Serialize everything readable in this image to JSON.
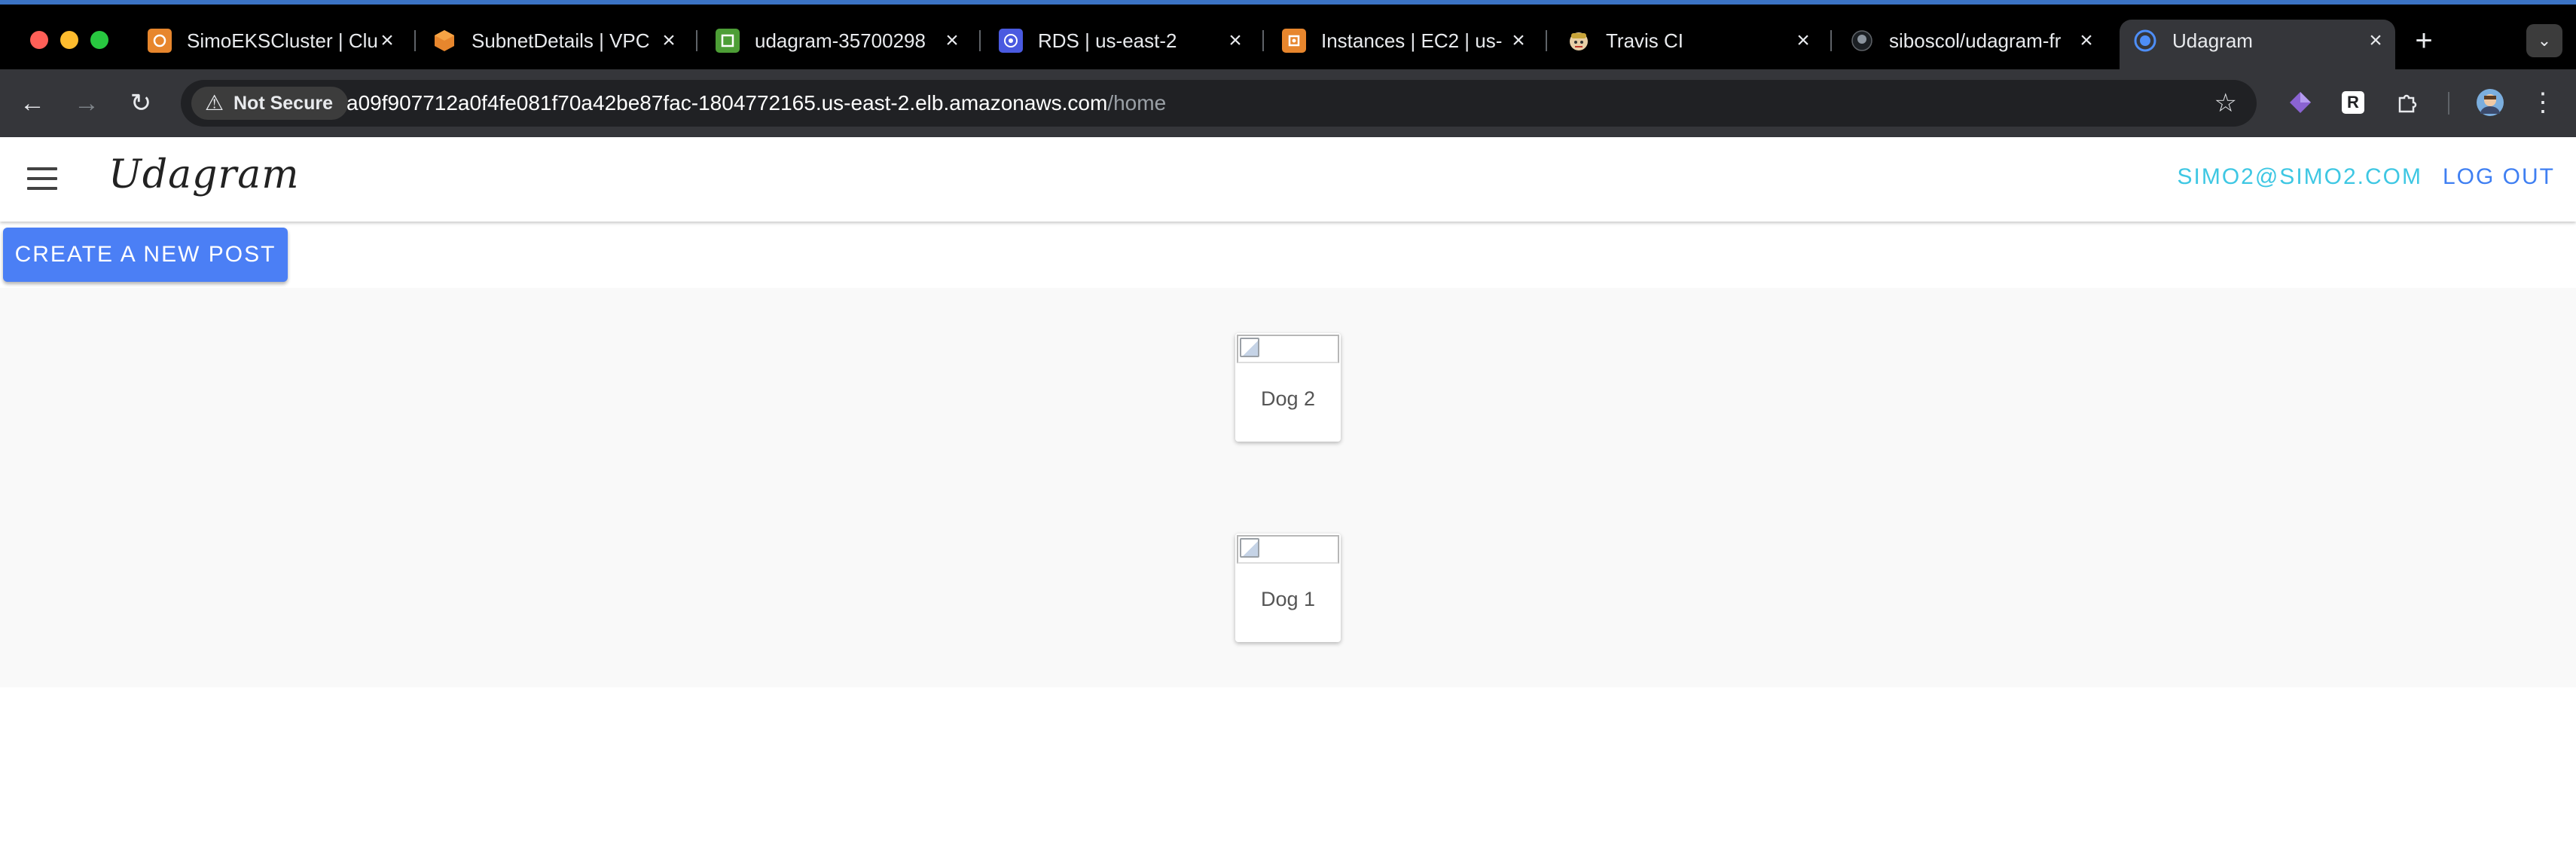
{
  "browser": {
    "tabs": [
      {
        "label": "SimoEKSCluster | Clu",
        "icon": "aws-eks-icon",
        "color": "#e7862d"
      },
      {
        "label": "SubnetDetails | VPC",
        "icon": "aws-vpc-icon",
        "color": "#e7862d"
      },
      {
        "label": "udagram-35700298",
        "icon": "aws-elb-icon",
        "color": "#4d9e36"
      },
      {
        "label": "RDS | us-east-2",
        "icon": "aws-rds-icon",
        "color": "#4a5ae0"
      },
      {
        "label": "Instances | EC2 | us-",
        "icon": "aws-ec2-icon",
        "color": "#e7862d"
      },
      {
        "label": "Travis CI",
        "icon": "travis-ci-icon",
        "color": "#c8a43a"
      },
      {
        "label": "siboscol/udagram-fr",
        "icon": "github-icon",
        "color": "#24292e"
      },
      {
        "label": "Udagram",
        "icon": "chrome-default-icon",
        "color": "#4e8ef7"
      }
    ],
    "security_label": "Not Secure",
    "url_host": "a09f907712a0f4fe081f70a42be87fac-1804772165.us-east-2.elb.amazonaws.com",
    "url_path": "/home",
    "extensions": [
      {
        "icon": "gem-extension-icon",
        "color": "#8a63d2"
      },
      {
        "icon": "r-extension-icon",
        "text": "R",
        "color": "#ffffff"
      },
      {
        "icon": "puzzle-extensions-icon",
        "color": "#e8eaed"
      },
      {
        "icon": "profile-avatar-icon",
        "color": "#7baede"
      }
    ]
  },
  "app": {
    "brand": "Udagram",
    "user_email": "SIMO2@SIMO2.COM",
    "logout_label": "LOG OUT",
    "create_post_label": "CREATE A NEW POST",
    "posts": [
      {
        "caption": "Dog 2"
      },
      {
        "caption": "Dog 1"
      }
    ]
  }
}
